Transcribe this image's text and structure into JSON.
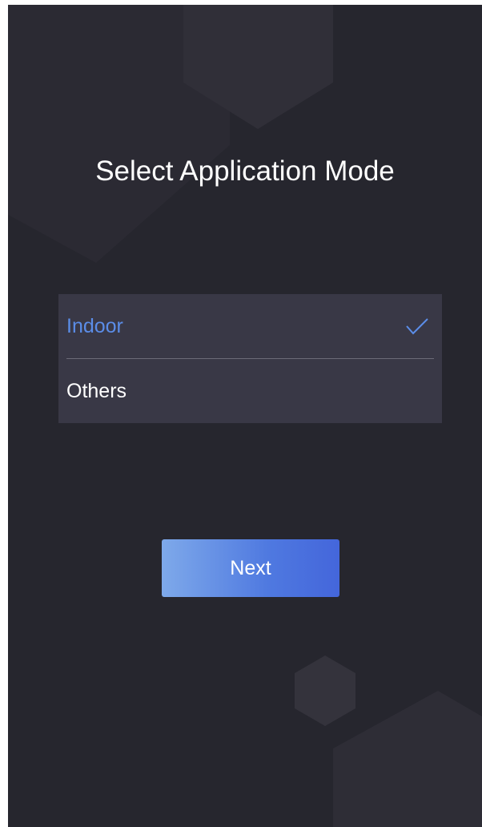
{
  "screen": {
    "title": "Select Application Mode"
  },
  "options": [
    {
      "label": "Indoor",
      "selected": true
    },
    {
      "label": "Others",
      "selected": false
    }
  ],
  "next_button": {
    "label": "Next"
  },
  "colors": {
    "background": "#26262e",
    "panel": "#393846",
    "accent": "#5b8de8",
    "button_gradient_start": "#7ea9ea",
    "button_gradient_end": "#4466db"
  }
}
